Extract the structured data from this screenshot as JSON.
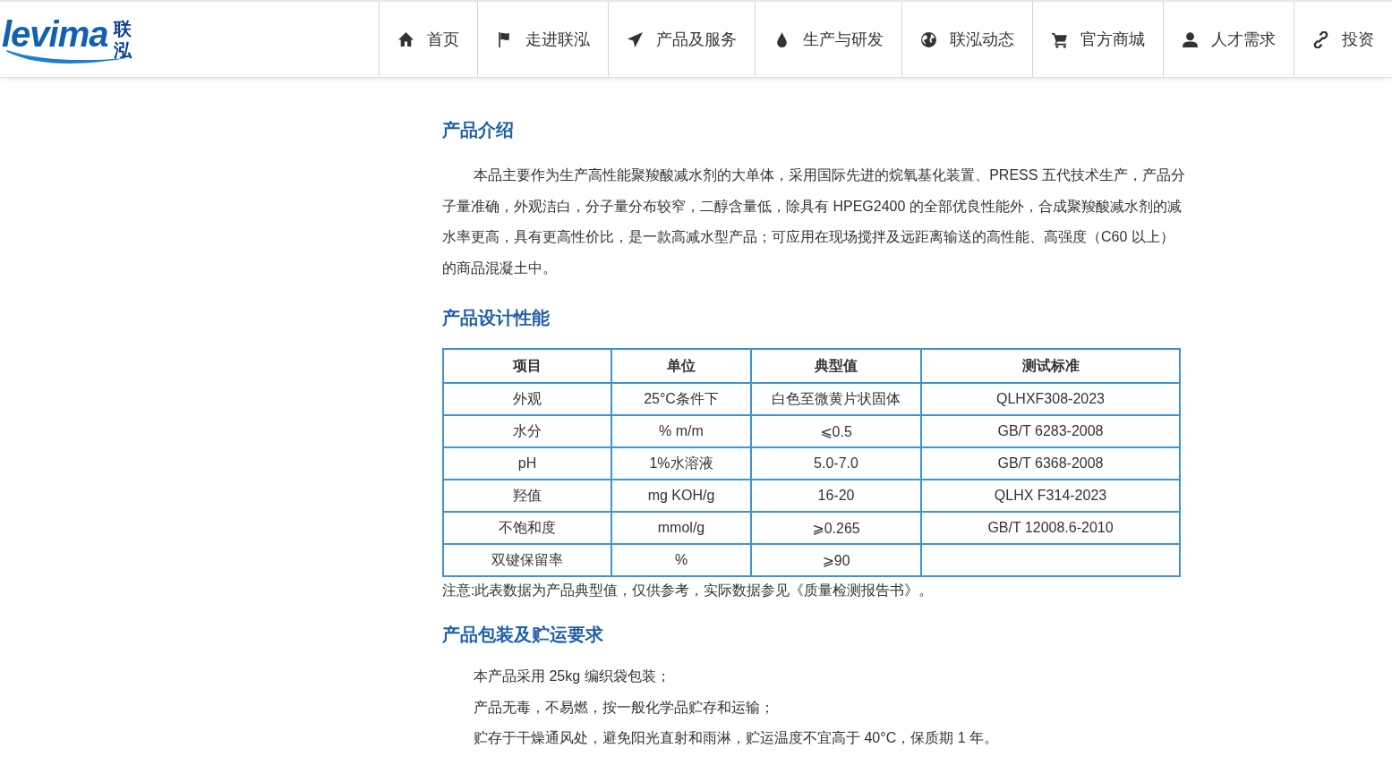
{
  "header": {
    "logo": {
      "wordmark": "levima",
      "name": "联泓"
    },
    "nav": [
      {
        "label": "首页",
        "kind": "home"
      },
      {
        "label": "走进联泓",
        "kind": "flag"
      },
      {
        "label": "产品及服务",
        "kind": "plane"
      },
      {
        "label": "生产与研发",
        "kind": "drop"
      },
      {
        "label": "联泓动态",
        "kind": "globe"
      },
      {
        "label": "官方商城",
        "kind": "cart"
      },
      {
        "label": "人才需求",
        "kind": "user"
      },
      {
        "label": "投资",
        "kind": "link"
      }
    ]
  },
  "sections": [
    {
      "heading": "产品介绍",
      "paragraphs": [
        "本品主要作为生产高性能聚羧酸减水剂的大单体，采用国际先进的烷氧基化装置、PRESS 五代技术生产，产品分子量准确，外观洁白，分子量分布较窄，二醇含量低，除具有 HPEG2400 的全部优良性能外，合成聚羧酸减水剂的减水率更高，具有更高性价比，是一款高减水型产品；可应用在现场搅拌及远距离输送的高性能、高强度（C60 以上）的商品混凝土中。"
      ]
    },
    {
      "heading": "产品设计性能",
      "table": {
        "columns": [
          "项目",
          "单位",
          "典型值",
          "测试标准"
        ],
        "rows": [
          [
            "外观",
            "25°C条件下",
            "白色至微黄片状固体",
            "QLHXF308-2023"
          ],
          [
            "水分",
            "% m/m",
            "⩽0.5",
            "GB/T 6283-2008"
          ],
          [
            "pH",
            "1%水溶液",
            "5.0-7.0",
            "GB/T 6368-2008"
          ],
          [
            "羟值",
            "mg KOH/g",
            "16-20",
            "QLHX F314-2023"
          ],
          [
            "不饱和度",
            "mmol/g",
            "⩾0.265",
            "GB/T 12008.6-2010"
          ],
          [
            "双键保留率",
            "%",
            "⩾90",
            ""
          ]
        ]
      },
      "note": "注意:此表数据为产品典型值，仅供参考，实际数据参见《质量检测报告书》。"
    },
    {
      "heading": "产品包装及贮运要求",
      "lines": [
        "本产品采用 25kg 编织袋包装；",
        "产品无毒，不易燃，按一般化学品贮存和运输；",
        "贮存于干燥通风处，避免阳光直射和雨淋，贮运温度不宜高于 40°C，保质期 1 年。"
      ]
    }
  ]
}
